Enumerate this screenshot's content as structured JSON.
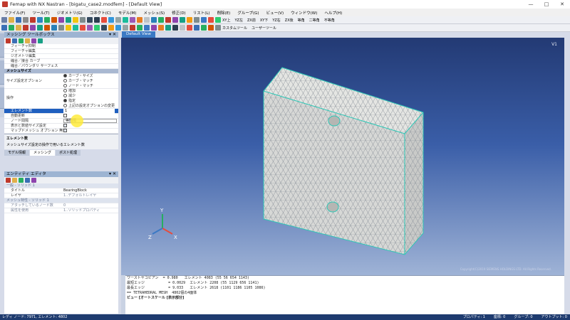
{
  "window": {
    "title": "Femap with NX Nastran - [bigatu_case2.modfem] - [Default View]",
    "controls": [
      "—",
      "□",
      "✕"
    ]
  },
  "menu": [
    "ファイル(F)",
    "ツール(T)",
    "ジオメトリ(G)",
    "コネクト(C)",
    "モデル(M)",
    "メッシュ(S)",
    "修正(D)",
    "リスト(L)",
    "削除(E)",
    "グループ(G)",
    "ビュー(V)",
    "ウィンドウ(W)",
    "ヘルプ(H)"
  ],
  "toolbar1_right": [
    "XY上",
    "YZ左",
    "ZX前",
    "XY下",
    "YZ右",
    "ZX後",
    "等角",
    "二等角",
    "不等角"
  ],
  "toolbar2_right": [
    "カスタムツール",
    "ユーザーツール"
  ],
  "side_tabs": [
    "モデル情報",
    "エンティティ",
    "データテーブル"
  ],
  "mesh_toolbox": {
    "title": "メッシング ツールボックス",
    "pin": "▾ ✕",
    "rows_top": [
      "フィーチャ抑制",
      "フィーチャ編集",
      "ジオメトリ編集",
      "縮合／接合 カーブ",
      "縮合／パウンダリ サーフェス"
    ],
    "section": "メッシュサイズ",
    "size_option_label": "サイズ設定オプション",
    "size_options": [
      "カーブ・サイズ",
      "カーブ・マッチ",
      "ノード・マッチ"
    ],
    "operation_label": "操作",
    "operations": [
      "増加",
      "減少",
      "指定",
      "上記の設定オプションの変更"
    ],
    "rows": [
      {
        "label": "エレメント数",
        "value": "1"
      },
      {
        "label": "自動更新",
        "value": ""
      },
      {
        "label": "ノード間隔",
        "value": "等間隔"
      },
      {
        "label": "表示と数値サイズ設定",
        "value": ""
      },
      {
        "label": "マップドメッシュ オプション 無効",
        "value": ""
      }
    ],
    "desc_title": "エレメント数",
    "desc_text": "メッシュサイズ設定の操作で用いるエレメント数"
  },
  "lower_tabs": [
    "モデル情報",
    "メッシング",
    "ポスト処理"
  ],
  "entity_editor": {
    "title": "エンティティ エディタ",
    "pin": "▾ ✕",
    "section": "一般 - ソリッド 1",
    "rows": [
      {
        "label": "タイトル",
        "value": "BearingBlock"
      },
      {
        "label": "レイヤ",
        "value": "1..デフォルトレイヤ"
      }
    ],
    "section2": "メッシュ特性 - ソリッド 1",
    "rows2": [
      {
        "label": "アタッチしているノード数",
        "value": "0"
      },
      {
        "label": "属性を使用",
        "value": "1..ソリッドプロパティ"
      }
    ]
  },
  "view": {
    "tab": "Default View",
    "label": "V1",
    "copyright": "Copyright(C)2019 SIEMENS HOLDINGS LTD. All Rights Reserved.",
    "axes": [
      "Z",
      "Y",
      "X"
    ]
  },
  "messages": [
    "ワーストヤコビアン  = 0.980   エレメント 4083 (55 56 654 1143)",
    "最短エッジ           = 0.0029  エレメント 2208 (55 1129 656 1141)",
    "最長エッジ           = 9.033   エレメント 2618 (1101 1186 1105 1086)",
    "",
    "== TETRAHEDRAL MESH  4802個の4面体"
  ],
  "message_bold": "ビュー [オートスケール [表示部分]",
  "status": {
    "left": "レディ ノード: 7971, エレメント: 4802",
    "right": [
      "プロパティ: 1",
      "座標: 0",
      "グループ: 0",
      "アウトプット: 0"
    ]
  },
  "colors": {
    "accent": "#1f5fbf",
    "mesh_edge": "#2ec7b6",
    "panel_head": "#9db4d2",
    "statusbar": "#1e3b6f"
  }
}
